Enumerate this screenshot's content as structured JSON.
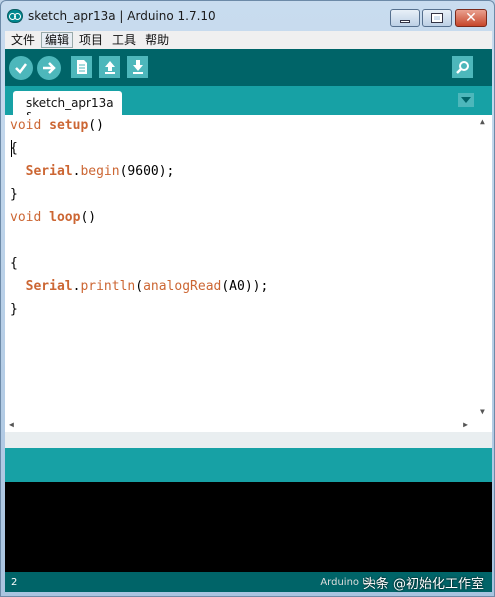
{
  "window": {
    "title": "sketch_apr13a | Arduino 1.7.10"
  },
  "menubar": {
    "items": [
      "文件",
      "编辑",
      "项目",
      "工具",
      "帮助"
    ]
  },
  "toolbar": {
    "icons": [
      "verify-icon",
      "upload-icon",
      "new-icon",
      "open-icon",
      "save-icon",
      "serial-monitor-icon"
    ]
  },
  "tabs": [
    {
      "label": "sketch_apr13a §"
    }
  ],
  "editor": {
    "lines": [
      {
        "parts": [
          [
            "kw",
            "void"
          ],
          [
            "t",
            " "
          ],
          [
            "fn",
            "setup"
          ],
          [
            "t",
            "()"
          ]
        ]
      },
      {
        "parts": [
          [
            "t",
            "{"
          ]
        ]
      },
      {
        "parts": [
          [
            "t",
            "  "
          ],
          [
            "serial",
            "Serial"
          ],
          [
            "t",
            "."
          ],
          [
            "method",
            "begin"
          ],
          [
            "t",
            "(9600);"
          ]
        ]
      },
      {
        "parts": [
          [
            "t",
            "}"
          ]
        ]
      },
      {
        "parts": [
          [
            "kw",
            "void"
          ],
          [
            "t",
            " "
          ],
          [
            "fn",
            "loop"
          ],
          [
            "t",
            "()"
          ]
        ]
      },
      {
        "parts": [
          [
            "t",
            ""
          ]
        ]
      },
      {
        "parts": [
          [
            "t",
            "{"
          ]
        ]
      },
      {
        "parts": [
          [
            "t",
            "  "
          ],
          [
            "serial",
            "Serial"
          ],
          [
            "t",
            "."
          ],
          [
            "method",
            "println"
          ],
          [
            "t",
            "("
          ],
          [
            "method",
            "analogRead"
          ],
          [
            "t",
            "(A0));"
          ]
        ]
      },
      {
        "parts": [
          [
            "t",
            "}"
          ]
        ]
      }
    ]
  },
  "footer": {
    "line_number": "2",
    "board": "Arduino Uno",
    "watermark": "头条 @初始化工作室"
  },
  "colors": {
    "toolbar": "#006468",
    "tabbar": "#17a1a5",
    "button": "#4db7bb",
    "keyword": "#cc6633"
  }
}
